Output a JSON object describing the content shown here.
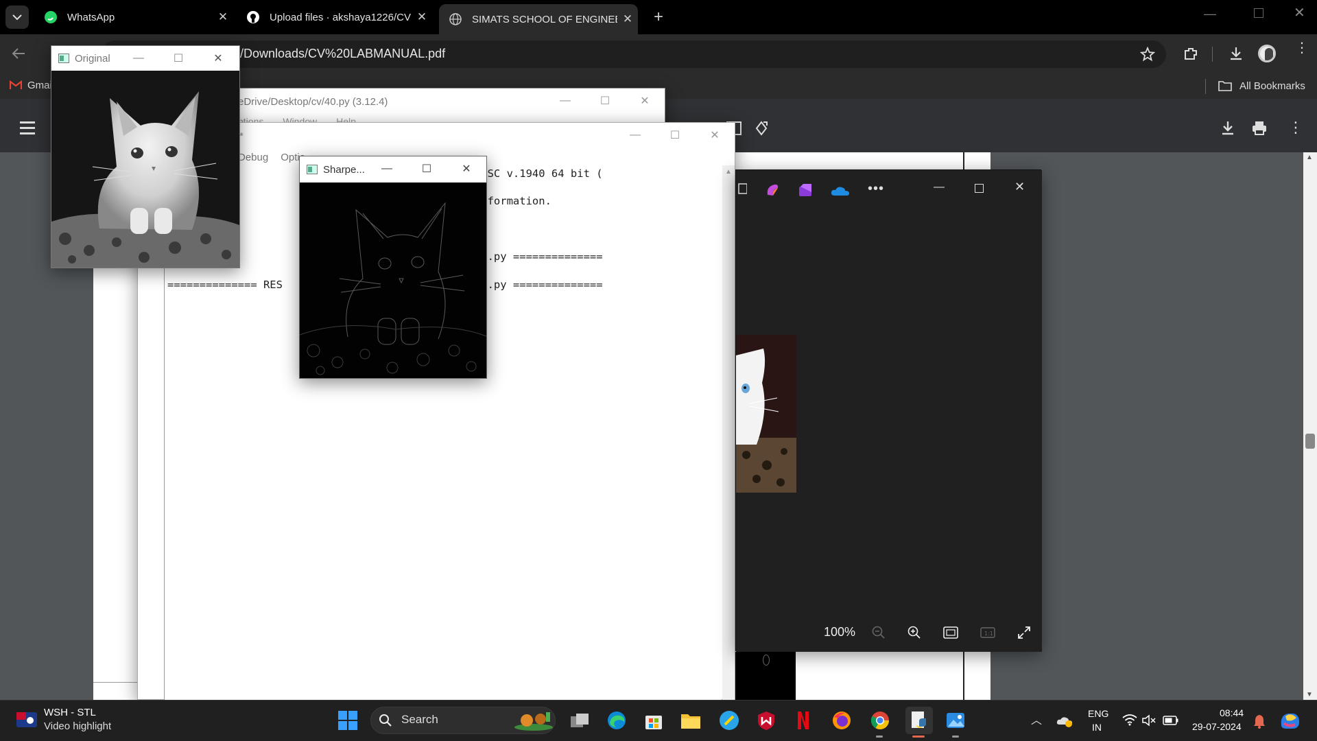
{
  "browser": {
    "tabs": [
      {
        "title": "WhatsApp",
        "active": false
      },
      {
        "title": "Upload files · akshaya1226/CV",
        "active": false
      },
      {
        "title": "SIMATS SCHOOL OF ENGINEERI",
        "active": true
      }
    ],
    "url": "/Downloads/CV%20LABMANUAL.pdf",
    "bookmarks_left": "Gmai",
    "bookmarks_right": "All Bookmarks",
    "accent": "#8ab4f8"
  },
  "idle_shell": {
    "title": "eDrive/Desktop/cv/40.py (3.12.4)",
    "menu_partial": [
      "ptions",
      "Window",
      "Help"
    ]
  },
  "idle_editor": {
    "title_mark": "*",
    "menu": [
      "Debug",
      "Optio"
    ],
    "lines": [
      "2.4 (tags                         24, 19:30:16) [MSC v.1940 64 bit (",
      " win32",
      "\", \"copyr                         e()\" for more information.",
      "",
      " C:/Users                          40.py",
      "",
      "===== RES                         ve/Desktop/cv/40.py ==============",
      "",
      "============== RES                ve/Desktop/cv/40.py =============="
    ]
  },
  "original_window": {
    "title": "Original"
  },
  "sharpened_window": {
    "title": "Sharpe..."
  },
  "photos": {
    "zoom": "100%"
  },
  "taskbar": {
    "weather_title": "WSH - STL",
    "weather_sub": "Video highlight",
    "search_placeholder": "Search",
    "lang_top": "ENG",
    "lang_bottom": "IN",
    "time": "08:44",
    "date": "29-07-2024"
  }
}
